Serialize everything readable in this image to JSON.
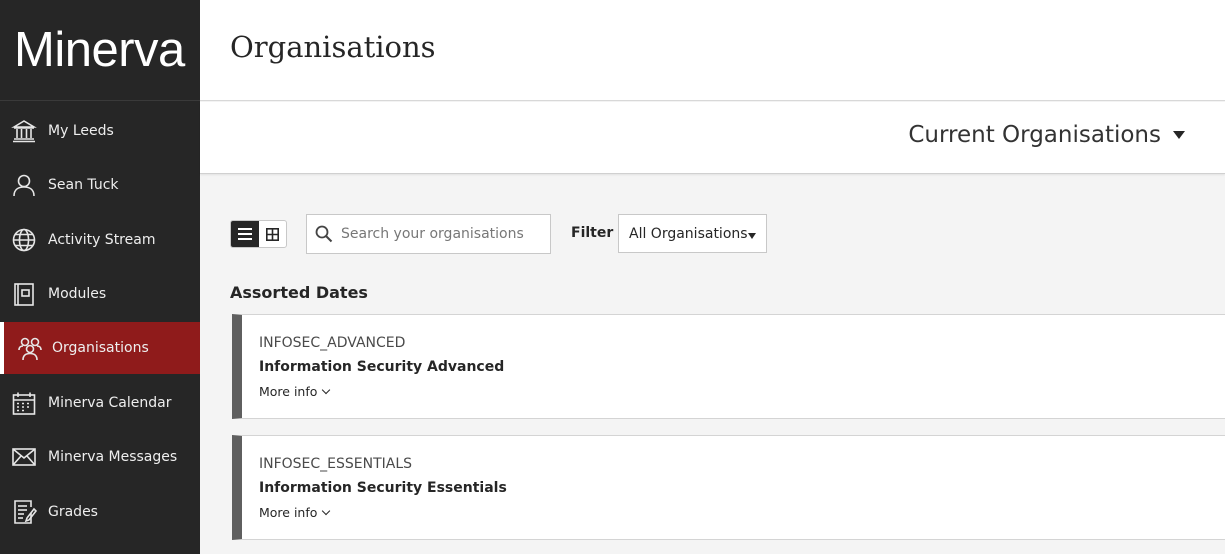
{
  "brand": {
    "name": "Minerva"
  },
  "sidebar": {
    "items": [
      {
        "label": "My Leeds",
        "icon": "institution-icon"
      },
      {
        "label": "Sean Tuck",
        "icon": "user-icon"
      },
      {
        "label": "Activity Stream",
        "icon": "globe-icon"
      },
      {
        "label": "Modules",
        "icon": "book-icon"
      },
      {
        "label": "Organisations",
        "icon": "people-icon",
        "active": true
      },
      {
        "label": "Minerva Calendar",
        "icon": "calendar-icon"
      },
      {
        "label": "Minerva Messages",
        "icon": "envelope-icon"
      },
      {
        "label": "Grades",
        "icon": "grades-icon"
      }
    ],
    "active_color": "#8f1b1b"
  },
  "header": {
    "title": "Organisations"
  },
  "subheader": {
    "current_label": "Current Organisations"
  },
  "toolbar": {
    "search_placeholder": "Search your organisations",
    "filter_label": "Filter",
    "filter_value": "All Organisations"
  },
  "section": {
    "title": "Assorted Dates"
  },
  "organisations": [
    {
      "code": "INFOSEC_ADVANCED",
      "name": "Information Security Advanced",
      "more": "More info"
    },
    {
      "code": "INFOSEC_ESSENTIALS",
      "name": "Information Security Essentials",
      "more": "More info"
    }
  ]
}
